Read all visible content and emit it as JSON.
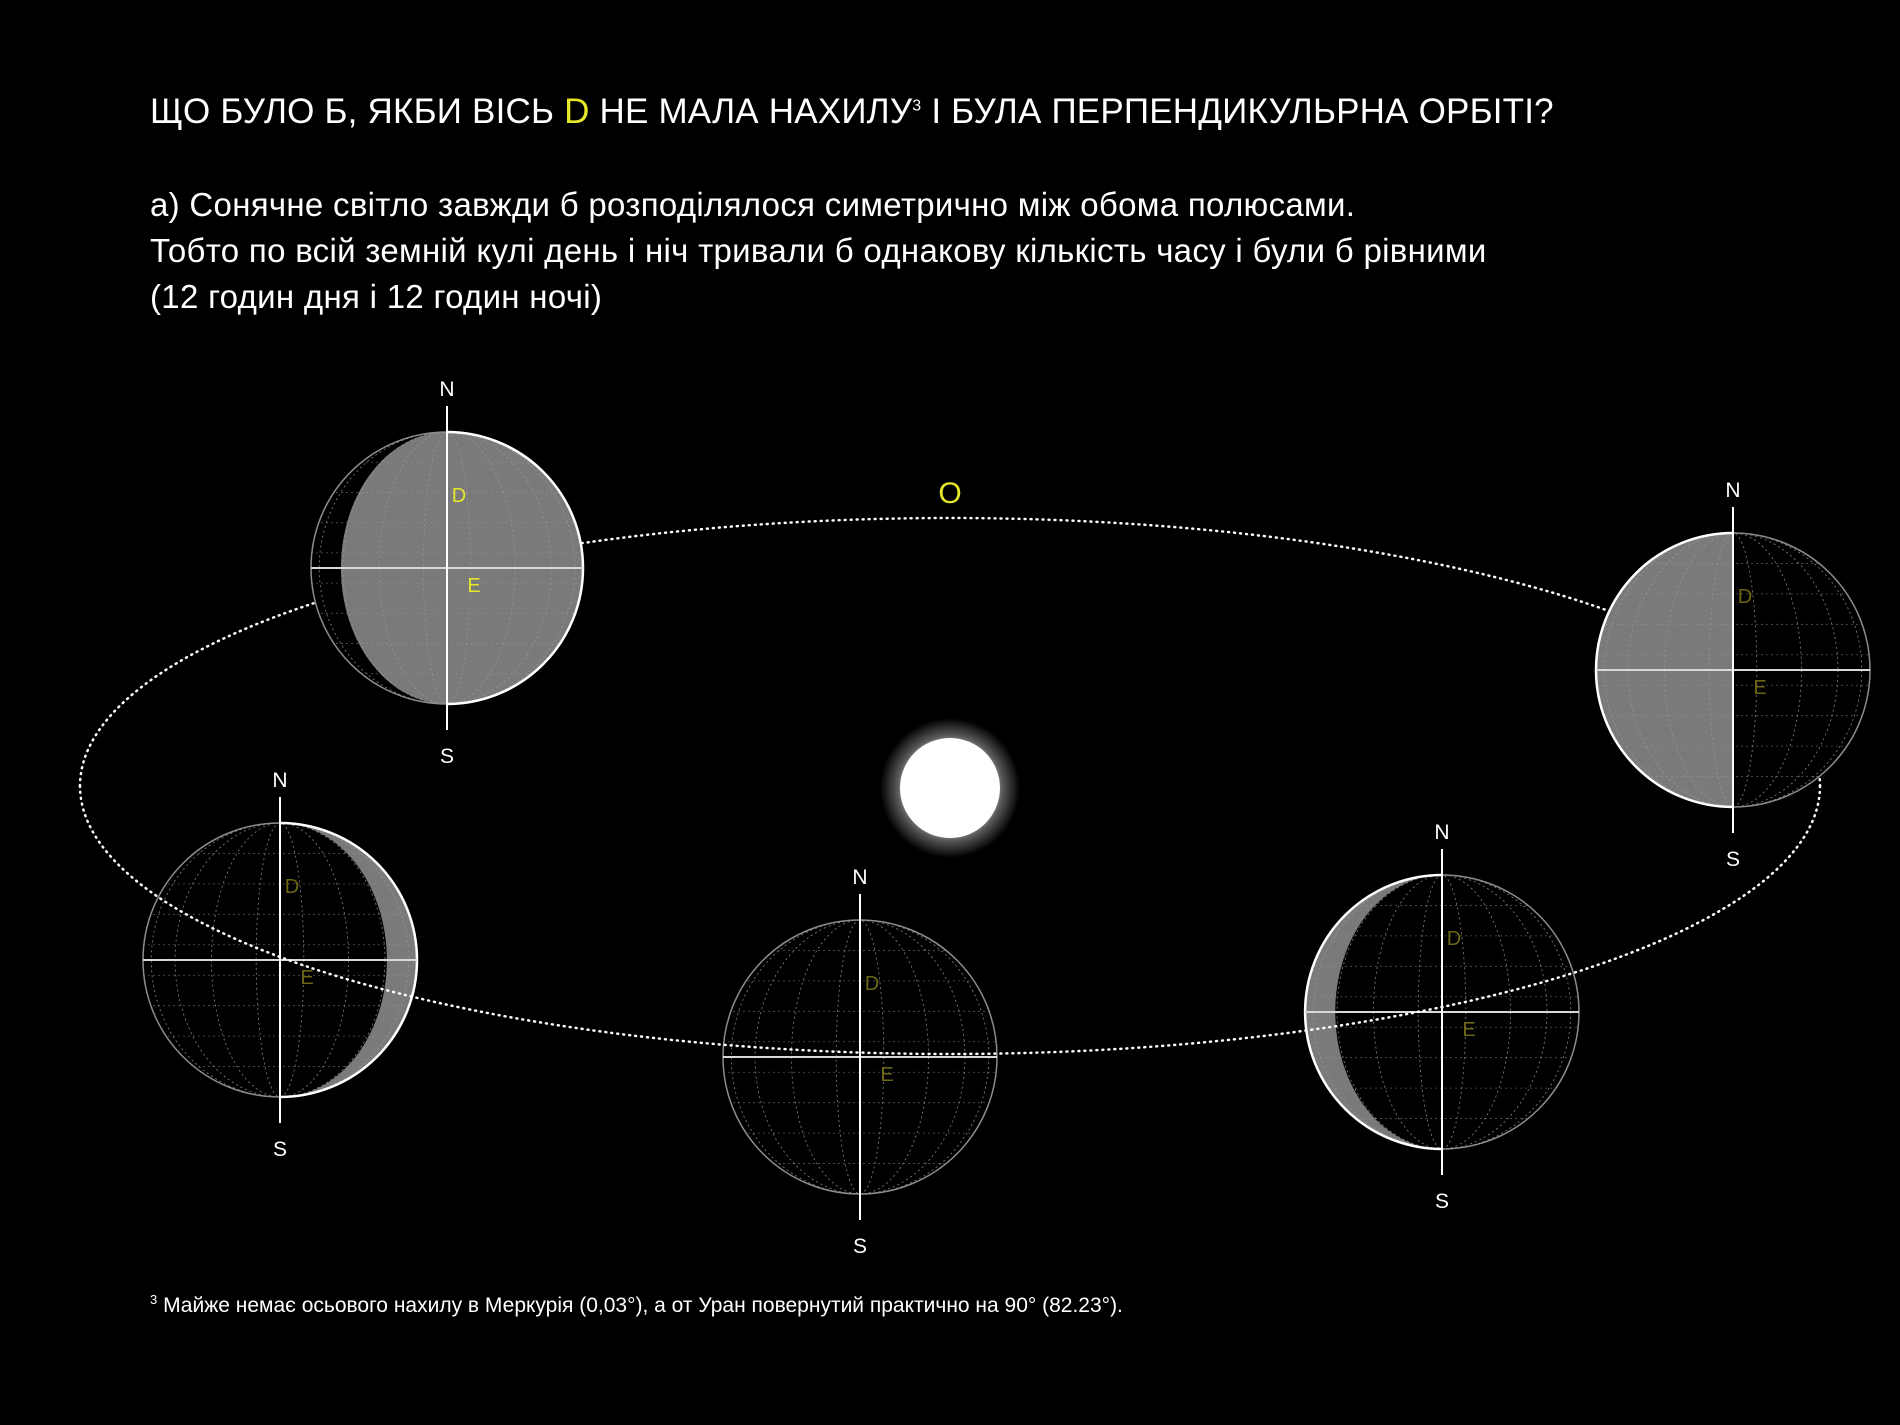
{
  "heading": {
    "before": "ЩО БУЛО Б, ЯКБИ ВІСЬ ",
    "highlight": "D",
    "after": " НЕ МАЛА НАХИЛУ",
    "sup": "3",
    "end": " І БУЛА ПЕРПЕНДИКУЛЬРНА ОРБІТІ?"
  },
  "paragraph": {
    "line1": "а) Сонячне світло завжди б розподілялося симетрично між обома полюсами.",
    "line2": "Тобто по всій земній кулі день і ніч тривали б однакову кількість часу і були б рівними",
    "line3": "(12 годин дня і 12 годин ночі)"
  },
  "diagram": {
    "orbit_label": "O",
    "pole_north": "N",
    "pole_south": "S",
    "axis_label": "D",
    "equator_label": "E"
  },
  "footnote": {
    "sup": "3",
    "text": " Майже немає осьового нахилу в Меркурія  (0,03°), а  от Уран повернутий практично на 90° (82.23°)."
  },
  "colors": {
    "background": "#000000",
    "highlight": "#e6e62a",
    "lit": "#7a7a7a",
    "dark": "#000000"
  }
}
